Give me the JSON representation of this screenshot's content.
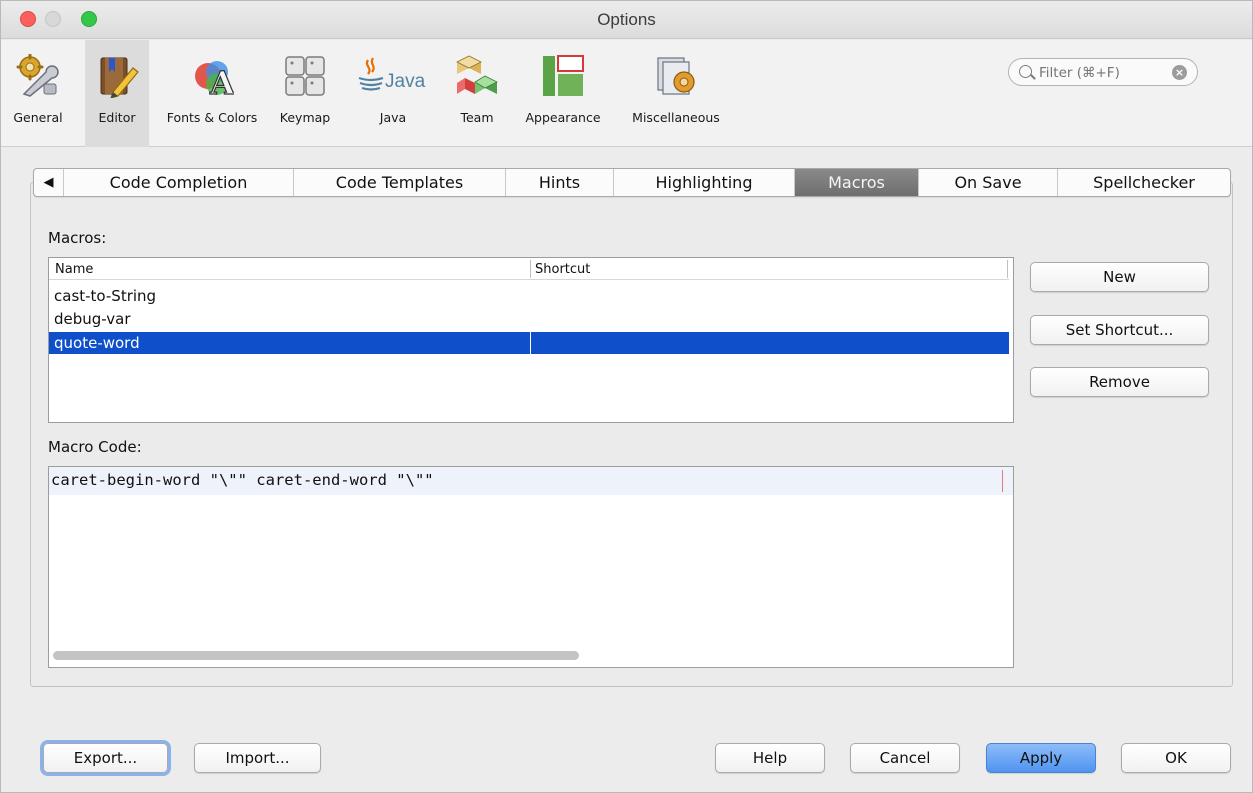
{
  "window": {
    "title": "Options"
  },
  "toolbar": {
    "items": [
      {
        "label": "General",
        "icon": "gear-wrench-icon"
      },
      {
        "label": "Editor",
        "icon": "book-pencil-icon",
        "active": true
      },
      {
        "label": "Fonts & Colors",
        "icon": "fonts-colors-icon"
      },
      {
        "label": "Keymap",
        "icon": "keyboard-icon"
      },
      {
        "label": "Java",
        "icon": "java-icon"
      },
      {
        "label": "Team",
        "icon": "team-cubes-icon"
      },
      {
        "label": "Appearance",
        "icon": "appearance-icon"
      },
      {
        "label": "Miscellaneous",
        "icon": "miscellaneous-icon"
      }
    ],
    "filter_placeholder": "Filter (⌘+F)"
  },
  "tabs": [
    {
      "label": "◀"
    },
    {
      "label": "Code Completion"
    },
    {
      "label": "Code Templates"
    },
    {
      "label": "Hints"
    },
    {
      "label": "Highlighting"
    },
    {
      "label": "Macros",
      "selected": true
    },
    {
      "label": "On Save"
    },
    {
      "label": "Spellchecker"
    }
  ],
  "macros": {
    "label": "Macros:",
    "columns": [
      "Name",
      "Shortcut"
    ],
    "rows": [
      {
        "name": "cast-to-String",
        "shortcut": ""
      },
      {
        "name": "debug-var",
        "shortcut": ""
      },
      {
        "name": "quote-word",
        "shortcut": "",
        "selected": true
      }
    ]
  },
  "side_buttons": {
    "new": "New",
    "set_shortcut": "Set Shortcut...",
    "remove": "Remove"
  },
  "macro_code": {
    "label": "Macro Code:",
    "text": "caret-begin-word \"\\\"\" caret-end-word \"\\\"\""
  },
  "footer": {
    "export": "Export...",
    "import": "Import...",
    "help": "Help",
    "cancel": "Cancel",
    "apply": "Apply",
    "ok": "OK"
  },
  "colors": {
    "selection": "#0f4fca",
    "apply_button": "#4f94f1",
    "tab_selected": "#7a7a7a"
  }
}
